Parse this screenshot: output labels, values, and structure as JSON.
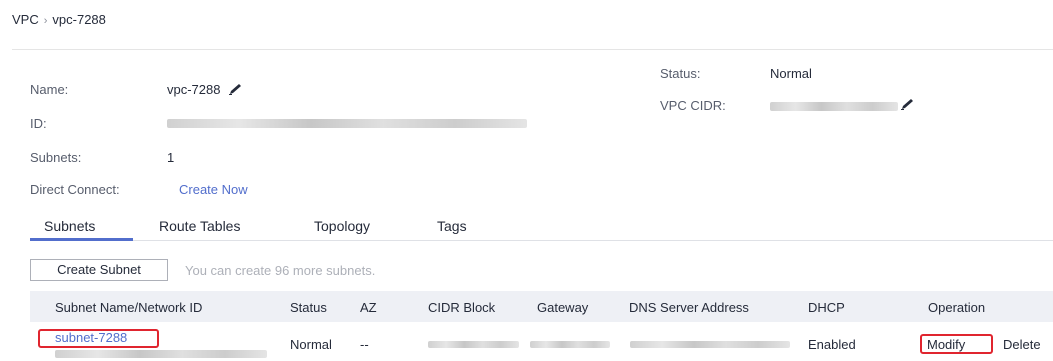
{
  "breadcrumb": {
    "root": "VPC",
    "separator": "›",
    "current": "vpc-7288"
  },
  "details": {
    "name_label": "Name:",
    "name_value": "vpc-7288",
    "id_label": "ID:",
    "subnets_label": "Subnets:",
    "subnets_value": "1",
    "direct_connect_label": "Direct Connect:",
    "direct_connect_link": "Create Now",
    "status_label": "Status:",
    "status_value": "Normal",
    "cidr_label": "VPC CIDR:"
  },
  "tabs": [
    {
      "label": "Subnets",
      "active": true
    },
    {
      "label": "Route Tables",
      "active": false
    },
    {
      "label": "Topology",
      "active": false
    },
    {
      "label": "Tags",
      "active": false
    }
  ],
  "toolbar": {
    "create_subnet_label": "Create Subnet",
    "hint": "You can create 96 more subnets."
  },
  "table": {
    "columns": [
      "Subnet Name/Network ID",
      "Status",
      "AZ",
      "CIDR Block",
      "Gateway",
      "DNS Server Address",
      "DHCP",
      "Operation"
    ],
    "rows": [
      {
        "name": "subnet-7288",
        "status": "Normal",
        "az": "--",
        "dhcp": "Enabled",
        "op_modify": "Modify",
        "op_delete": "Delete"
      }
    ]
  },
  "colors": {
    "link": "#526ecc",
    "highlight": "#e0252f",
    "header_bg": "#eef0f5"
  },
  "icons": {
    "edit": "pencil-icon"
  }
}
